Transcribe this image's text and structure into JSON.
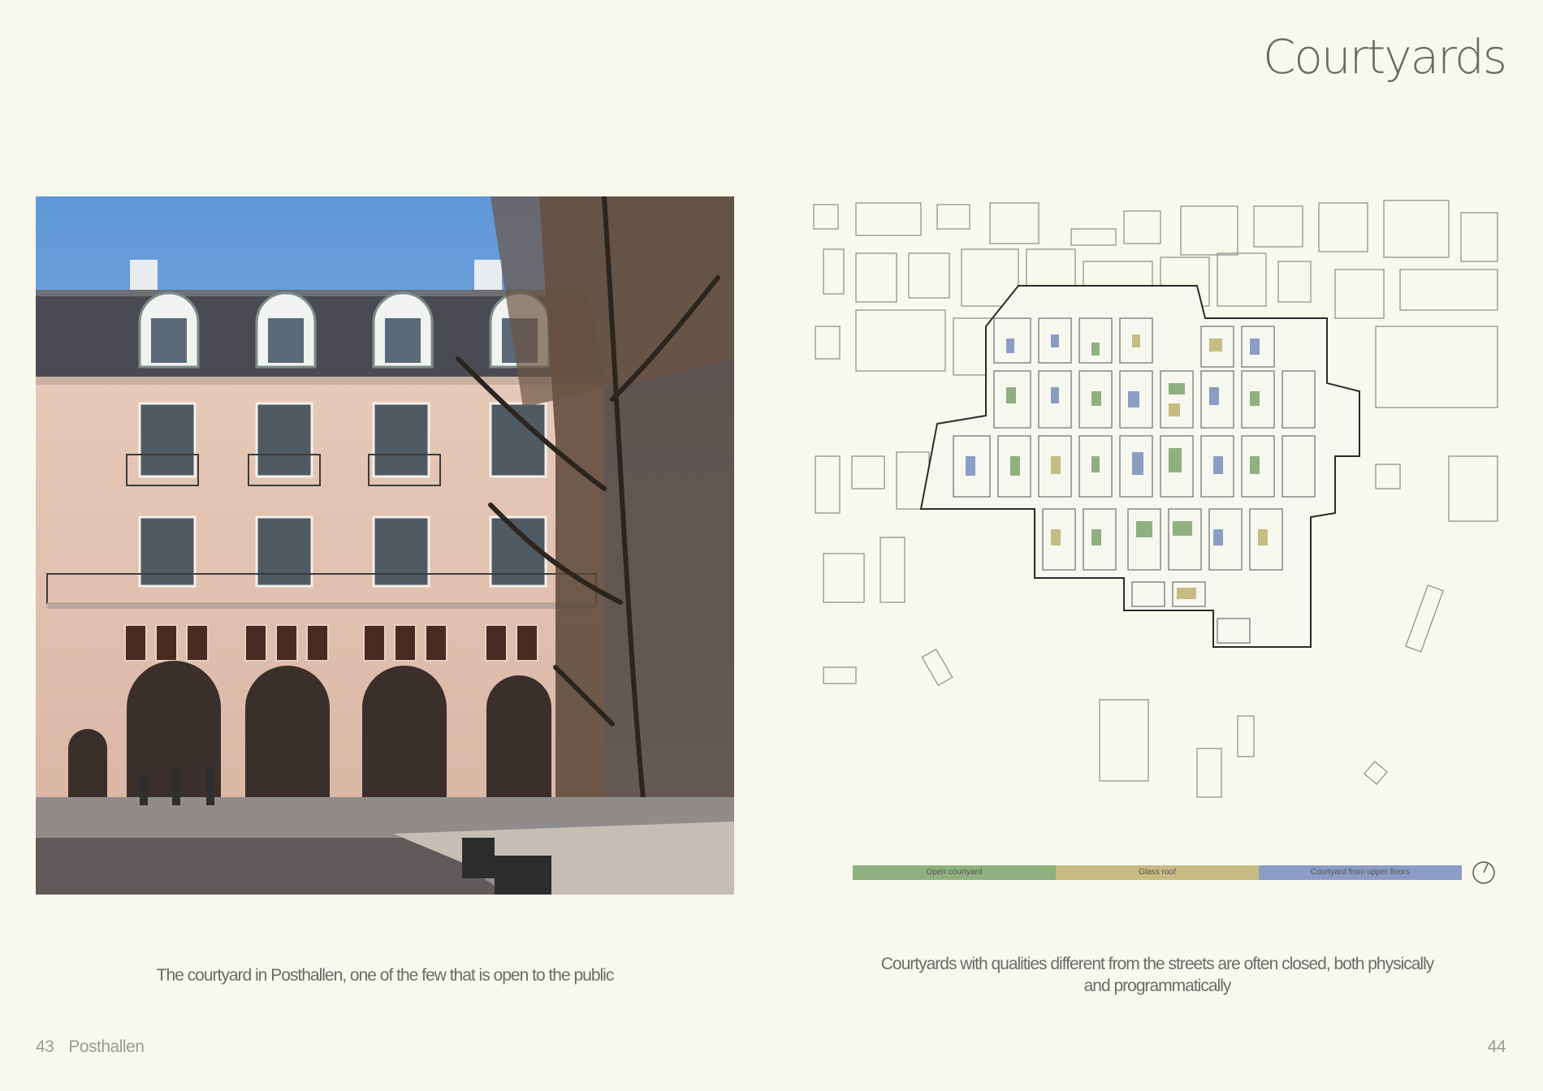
{
  "page_title": "Courtyards",
  "left": {
    "caption": "The courtyard in Posthallen, one of the few that is open to the public"
  },
  "right": {
    "caption": "Courtyards with qualities different from the streets are often closed, both physically and programmatically",
    "legend": [
      {
        "label": "Open courtyard",
        "color": "#8fb07f"
      },
      {
        "label": "Glass roof",
        "color": "#c6bc82"
      },
      {
        "label": "Courtyard from upper floors",
        "color": "#8b9dc4"
      }
    ]
  },
  "footer": {
    "left_page_number": "43",
    "left_section": "Posthallen",
    "right_page_number": "44"
  }
}
